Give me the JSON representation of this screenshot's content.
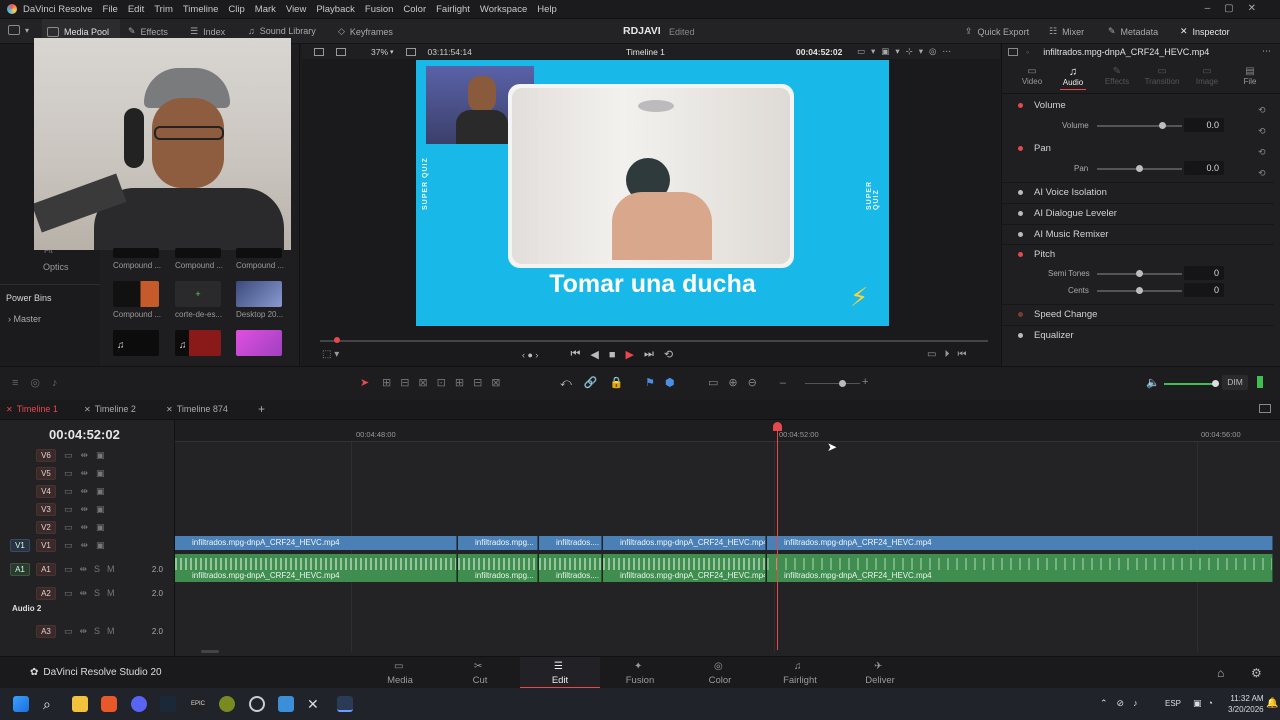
{
  "app": {
    "title": "DaVinci Resolve",
    "project": "RDJAVI",
    "status": "Edited",
    "studio": "DaVinci Resolve Studio 20"
  },
  "menu": [
    "File",
    "Edit",
    "Trim",
    "Timeline",
    "Clip",
    "Mark",
    "View",
    "Playback",
    "Fusion",
    "Color",
    "Fairlight",
    "Workspace",
    "Help"
  ],
  "toolbar": {
    "media_pool": "Media Pool",
    "effects": "Effects",
    "index": "Index",
    "sound_library": "Sound Library",
    "keyframes": "Keyframes",
    "quick_export": "Quick Export",
    "mixer": "Mixer",
    "metadata": "Metadata",
    "inspector": "Inspector"
  },
  "viewer": {
    "zoom": "37%",
    "source_tc": "03:11:54:14",
    "timeline_name": "Timeline 1",
    "timecode": "00:04:52:02",
    "caption": "Tomar una ducha",
    "side_text": "SUPER QUIZ"
  },
  "mediapool": {
    "bins_labels": [
      "Optics",
      "Power Bins",
      "Master",
      "Fit"
    ],
    "items": [
      "Compound ...",
      "Compound ...",
      "Compound ...",
      "Compound ...",
      "corte-de-es...",
      "Desktop 20..."
    ]
  },
  "inspector": {
    "clip_name": "infiltrados.mpg-dnpA_CRF24_HEVC.mp4",
    "tabs": [
      "Video",
      "Audio",
      "Effects",
      "Transition",
      "Image",
      "File"
    ],
    "volume": "Volume",
    "volume_label": "Volume",
    "volume_val": "0.0",
    "pan": "Pan",
    "pan_label": "Pan",
    "pan_val": "0.0",
    "ai_voice": "AI Voice Isolation",
    "ai_dialogue": "AI Dialogue Leveler",
    "ai_music": "AI Music Remixer",
    "pitch": "Pitch",
    "semitones": "Semi Tones",
    "semitones_val": "0",
    "cents": "Cents",
    "cents_val": "0",
    "speed_change": "Speed Change",
    "equalizer": "Equalizer"
  },
  "tools": {
    "dim": "DIM"
  },
  "timeline": {
    "tabs": [
      "Timeline 1",
      "Timeline 2",
      "Timeline 874"
    ],
    "timecode": "00:04:52:02",
    "ruler": [
      "00:04:48:00",
      "00:04:52:00",
      "00:04:56:00"
    ],
    "tracks_v": [
      "V6",
      "V5",
      "V4",
      "V3",
      "V2",
      "V1"
    ],
    "tracks_a": [
      "A1",
      "A2",
      "A3"
    ],
    "v1_dest": "V1",
    "a1_dest": "A1",
    "audio2": "Audio 2",
    "vol_a1": "2.0",
    "vol_a2": "2.0",
    "vol_a3": "2.0",
    "clips": [
      "infiltrados.mpg-dnpA_CRF24_HEVC.mp4",
      "infiltrados.mpg...",
      "infiltrados....",
      "infiltrados.mpg-dnpA_CRF24_HEVC.mp4",
      "infiltrados.mpg-dnpA_CRF24_HEVC.mp4"
    ]
  },
  "pages": [
    "Media",
    "Cut",
    "Edit",
    "Fusion",
    "Color",
    "Fairlight",
    "Deliver"
  ],
  "taskbar": {
    "lang": "ESP",
    "time": "11:32 AM",
    "date": "3/20/2026"
  },
  "colors": {
    "accent": "#e5484d",
    "video_clip": "#4a80b5",
    "audio_clip": "#3f8e4f",
    "viewer_bg": "#18b9e8"
  }
}
